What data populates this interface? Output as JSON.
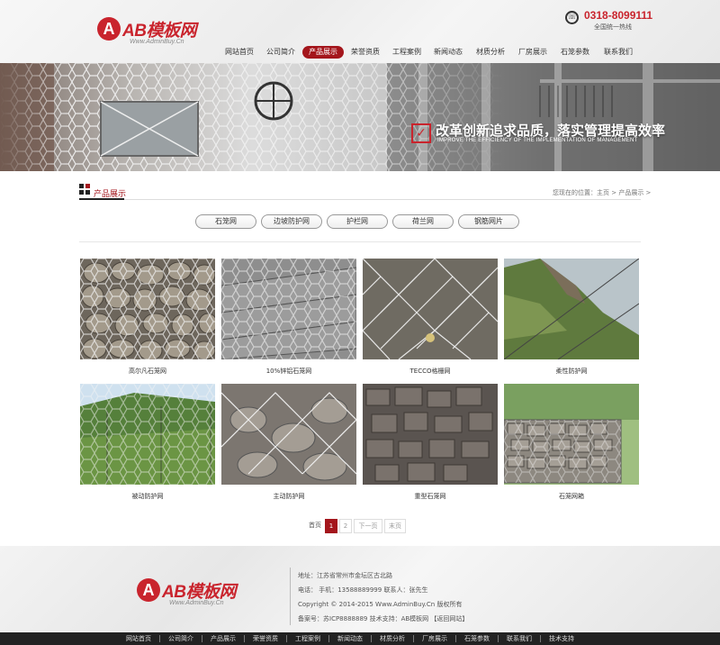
{
  "header": {
    "logo_mark": "A",
    "logo_text": "AB模板网",
    "logo_sub": "Www.AdminBuy.Cn",
    "phone_number": "0318-8099111",
    "phone_label": "全国统一热线",
    "nav": [
      {
        "label": "网站首页"
      },
      {
        "label": "公司简介"
      },
      {
        "label": "产品展示",
        "active": true
      },
      {
        "label": "荣誉资质"
      },
      {
        "label": "工程案例"
      },
      {
        "label": "新闻动态"
      },
      {
        "label": "材质分析"
      },
      {
        "label": "厂房展示"
      },
      {
        "label": "石笼参数"
      },
      {
        "label": "联系我们"
      }
    ]
  },
  "banner": {
    "slogan_main": "改革创新追求品质，落实管理提高效率",
    "slogan_sub": "IMPROVE THE EFFICIENCY OF THE IMPLEMENTATION OF MANAGEMENT"
  },
  "section": {
    "title": "产品展示",
    "breadcrumb": "您现在的位置：主页 > 产品展示 >"
  },
  "categories": [
    "石笼网",
    "边坡防护网",
    "护栏网",
    "荷兰网",
    "钢筋网片"
  ],
  "products": [
    {
      "name": "高尔凡石笼网"
    },
    {
      "name": "10%锌铝石笼网"
    },
    {
      "name": "TECCO格栅网"
    },
    {
      "name": "柔性防护网"
    },
    {
      "name": "被动防护网"
    },
    {
      "name": "主动防护网"
    },
    {
      "name": "重型石笼网"
    },
    {
      "name": "石笼网箱"
    }
  ],
  "pagination": {
    "first": "首页",
    "current": "1",
    "page2": "2",
    "next": "下一页",
    "last": "末页"
  },
  "footer": {
    "address": "地址：江苏省常州市金坛区古北路",
    "contact": "电话： 手机：13588889999 联系人：张先生",
    "copyright": "Copyright © 2014-2015 Www.AdminBuy.Cn 版权所有",
    "icp": "备案号：苏ICP8888889    技术支持：AB模板网 【返回网站】",
    "nav": [
      "网站首页",
      "公司简介",
      "产品展示",
      "荣誉资质",
      "工程案例",
      "新闻动态",
      "材质分析",
      "厂房展示",
      "石笼参数",
      "联系我们",
      "技术支持"
    ]
  },
  "colors": {
    "brand": "#c9242d",
    "nav_active": "#a4161c"
  }
}
